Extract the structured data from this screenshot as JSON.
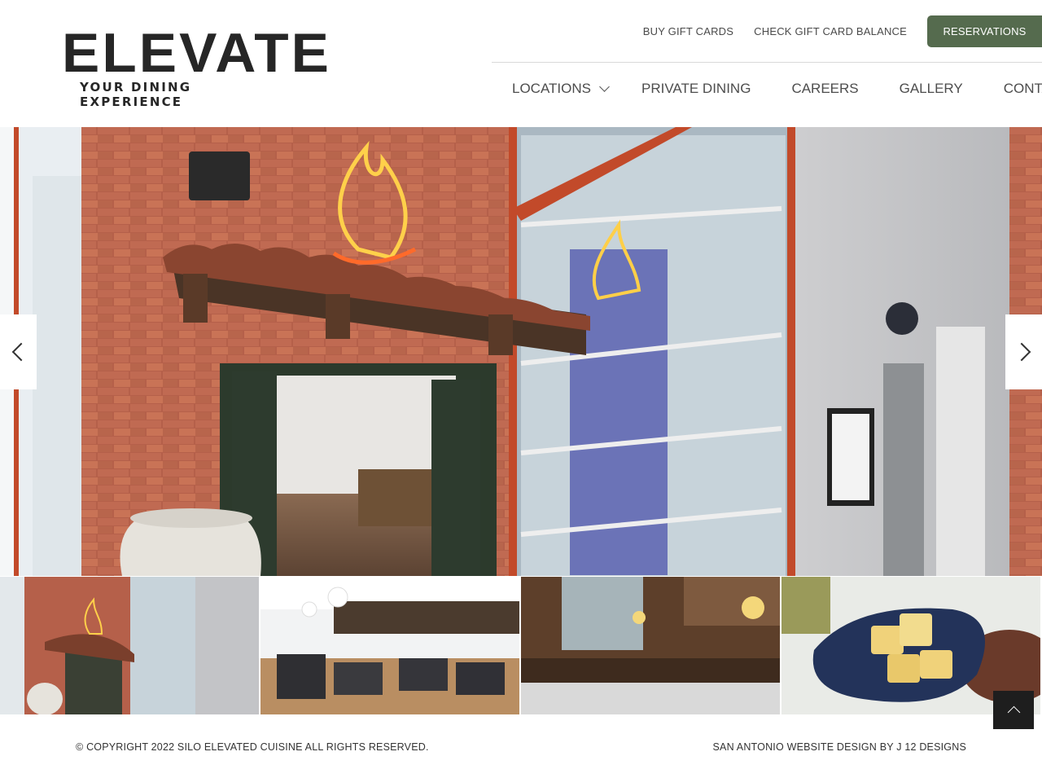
{
  "brand": {
    "name": "ELEVATE",
    "tagline": "YOUR DINING EXPERIENCE"
  },
  "utility_nav": {
    "buy_gift_cards": "BUY GIFT CARDS",
    "check_balance": "CHECK GIFT CARD BALANCE",
    "reservations": "RESERVATIONS"
  },
  "main_nav": {
    "items": [
      {
        "label": "LOCATIONS",
        "icon": "chevron-down-icon"
      },
      {
        "label": "PRIVATE DINING"
      },
      {
        "label": "CAREERS"
      },
      {
        "label": "GALLERY"
      },
      {
        "label": "CONTACT"
      }
    ]
  },
  "slider": {
    "prev_icon": "chevron-left-icon",
    "next_icon": "chevron-right-icon",
    "thumbnail_count": 4
  },
  "back_to_top": {
    "icon": "chevron-up-icon"
  },
  "footer": {
    "copyright": "© COPYRIGHT 2022 SILO ELEVATED CUISINE ALL RIGHTS RESERVED.",
    "credit": "SAN ANTONIO WEBSITE DESIGN BY J 12 DESIGNS"
  },
  "colors": {
    "reservations_button": "#556b4e",
    "back_to_top": "#1e1e1e",
    "text": "#333333"
  }
}
